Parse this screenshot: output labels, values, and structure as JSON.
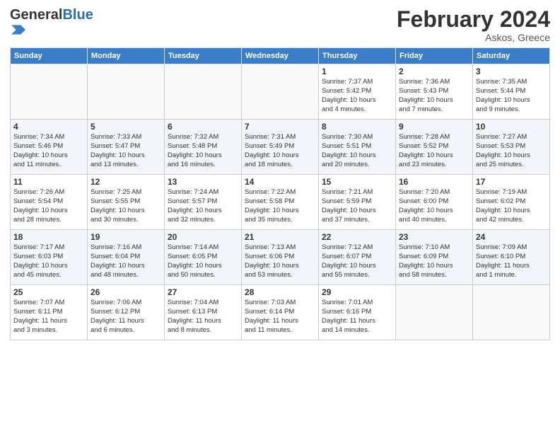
{
  "header": {
    "logo_general": "General",
    "logo_blue": "Blue",
    "month_year": "February 2024",
    "location": "Askos, Greece"
  },
  "days_of_week": [
    "Sunday",
    "Monday",
    "Tuesday",
    "Wednesday",
    "Thursday",
    "Friday",
    "Saturday"
  ],
  "weeks": [
    {
      "days": [
        {
          "num": "",
          "info": ""
        },
        {
          "num": "",
          "info": ""
        },
        {
          "num": "",
          "info": ""
        },
        {
          "num": "",
          "info": ""
        },
        {
          "num": "1",
          "info": "Sunrise: 7:37 AM\nSunset: 5:42 PM\nDaylight: 10 hours\nand 4 minutes."
        },
        {
          "num": "2",
          "info": "Sunrise: 7:36 AM\nSunset: 5:43 PM\nDaylight: 10 hours\nand 7 minutes."
        },
        {
          "num": "3",
          "info": "Sunrise: 7:35 AM\nSunset: 5:44 PM\nDaylight: 10 hours\nand 9 minutes."
        }
      ]
    },
    {
      "days": [
        {
          "num": "4",
          "info": "Sunrise: 7:34 AM\nSunset: 5:46 PM\nDaylight: 10 hours\nand 11 minutes."
        },
        {
          "num": "5",
          "info": "Sunrise: 7:33 AM\nSunset: 5:47 PM\nDaylight: 10 hours\nand 13 minutes."
        },
        {
          "num": "6",
          "info": "Sunrise: 7:32 AM\nSunset: 5:48 PM\nDaylight: 10 hours\nand 16 minutes."
        },
        {
          "num": "7",
          "info": "Sunrise: 7:31 AM\nSunset: 5:49 PM\nDaylight: 10 hours\nand 18 minutes."
        },
        {
          "num": "8",
          "info": "Sunrise: 7:30 AM\nSunset: 5:51 PM\nDaylight: 10 hours\nand 20 minutes."
        },
        {
          "num": "9",
          "info": "Sunrise: 7:28 AM\nSunset: 5:52 PM\nDaylight: 10 hours\nand 23 minutes."
        },
        {
          "num": "10",
          "info": "Sunrise: 7:27 AM\nSunset: 5:53 PM\nDaylight: 10 hours\nand 25 minutes."
        }
      ]
    },
    {
      "days": [
        {
          "num": "11",
          "info": "Sunrise: 7:26 AM\nSunset: 5:54 PM\nDaylight: 10 hours\nand 28 minutes."
        },
        {
          "num": "12",
          "info": "Sunrise: 7:25 AM\nSunset: 5:55 PM\nDaylight: 10 hours\nand 30 minutes."
        },
        {
          "num": "13",
          "info": "Sunrise: 7:24 AM\nSunset: 5:57 PM\nDaylight: 10 hours\nand 32 minutes."
        },
        {
          "num": "14",
          "info": "Sunrise: 7:22 AM\nSunset: 5:58 PM\nDaylight: 10 hours\nand 35 minutes."
        },
        {
          "num": "15",
          "info": "Sunrise: 7:21 AM\nSunset: 5:59 PM\nDaylight: 10 hours\nand 37 minutes."
        },
        {
          "num": "16",
          "info": "Sunrise: 7:20 AM\nSunset: 6:00 PM\nDaylight: 10 hours\nand 40 minutes."
        },
        {
          "num": "17",
          "info": "Sunrise: 7:19 AM\nSunset: 6:02 PM\nDaylight: 10 hours\nand 42 minutes."
        }
      ]
    },
    {
      "days": [
        {
          "num": "18",
          "info": "Sunrise: 7:17 AM\nSunset: 6:03 PM\nDaylight: 10 hours\nand 45 minutes."
        },
        {
          "num": "19",
          "info": "Sunrise: 7:16 AM\nSunset: 6:04 PM\nDaylight: 10 hours\nand 48 minutes."
        },
        {
          "num": "20",
          "info": "Sunrise: 7:14 AM\nSunset: 6:05 PM\nDaylight: 10 hours\nand 50 minutes."
        },
        {
          "num": "21",
          "info": "Sunrise: 7:13 AM\nSunset: 6:06 PM\nDaylight: 10 hours\nand 53 minutes."
        },
        {
          "num": "22",
          "info": "Sunrise: 7:12 AM\nSunset: 6:07 PM\nDaylight: 10 hours\nand 55 minutes."
        },
        {
          "num": "23",
          "info": "Sunrise: 7:10 AM\nSunset: 6:09 PM\nDaylight: 10 hours\nand 58 minutes."
        },
        {
          "num": "24",
          "info": "Sunrise: 7:09 AM\nSunset: 6:10 PM\nDaylight: 11 hours\nand 1 minute."
        }
      ]
    },
    {
      "days": [
        {
          "num": "25",
          "info": "Sunrise: 7:07 AM\nSunset: 6:11 PM\nDaylight: 11 hours\nand 3 minutes."
        },
        {
          "num": "26",
          "info": "Sunrise: 7:06 AM\nSunset: 6:12 PM\nDaylight: 11 hours\nand 6 minutes."
        },
        {
          "num": "27",
          "info": "Sunrise: 7:04 AM\nSunset: 6:13 PM\nDaylight: 11 hours\nand 8 minutes."
        },
        {
          "num": "28",
          "info": "Sunrise: 7:03 AM\nSunset: 6:14 PM\nDaylight: 11 hours\nand 11 minutes."
        },
        {
          "num": "29",
          "info": "Sunrise: 7:01 AM\nSunset: 6:16 PM\nDaylight: 11 hours\nand 14 minutes."
        },
        {
          "num": "",
          "info": ""
        },
        {
          "num": "",
          "info": ""
        }
      ]
    }
  ]
}
